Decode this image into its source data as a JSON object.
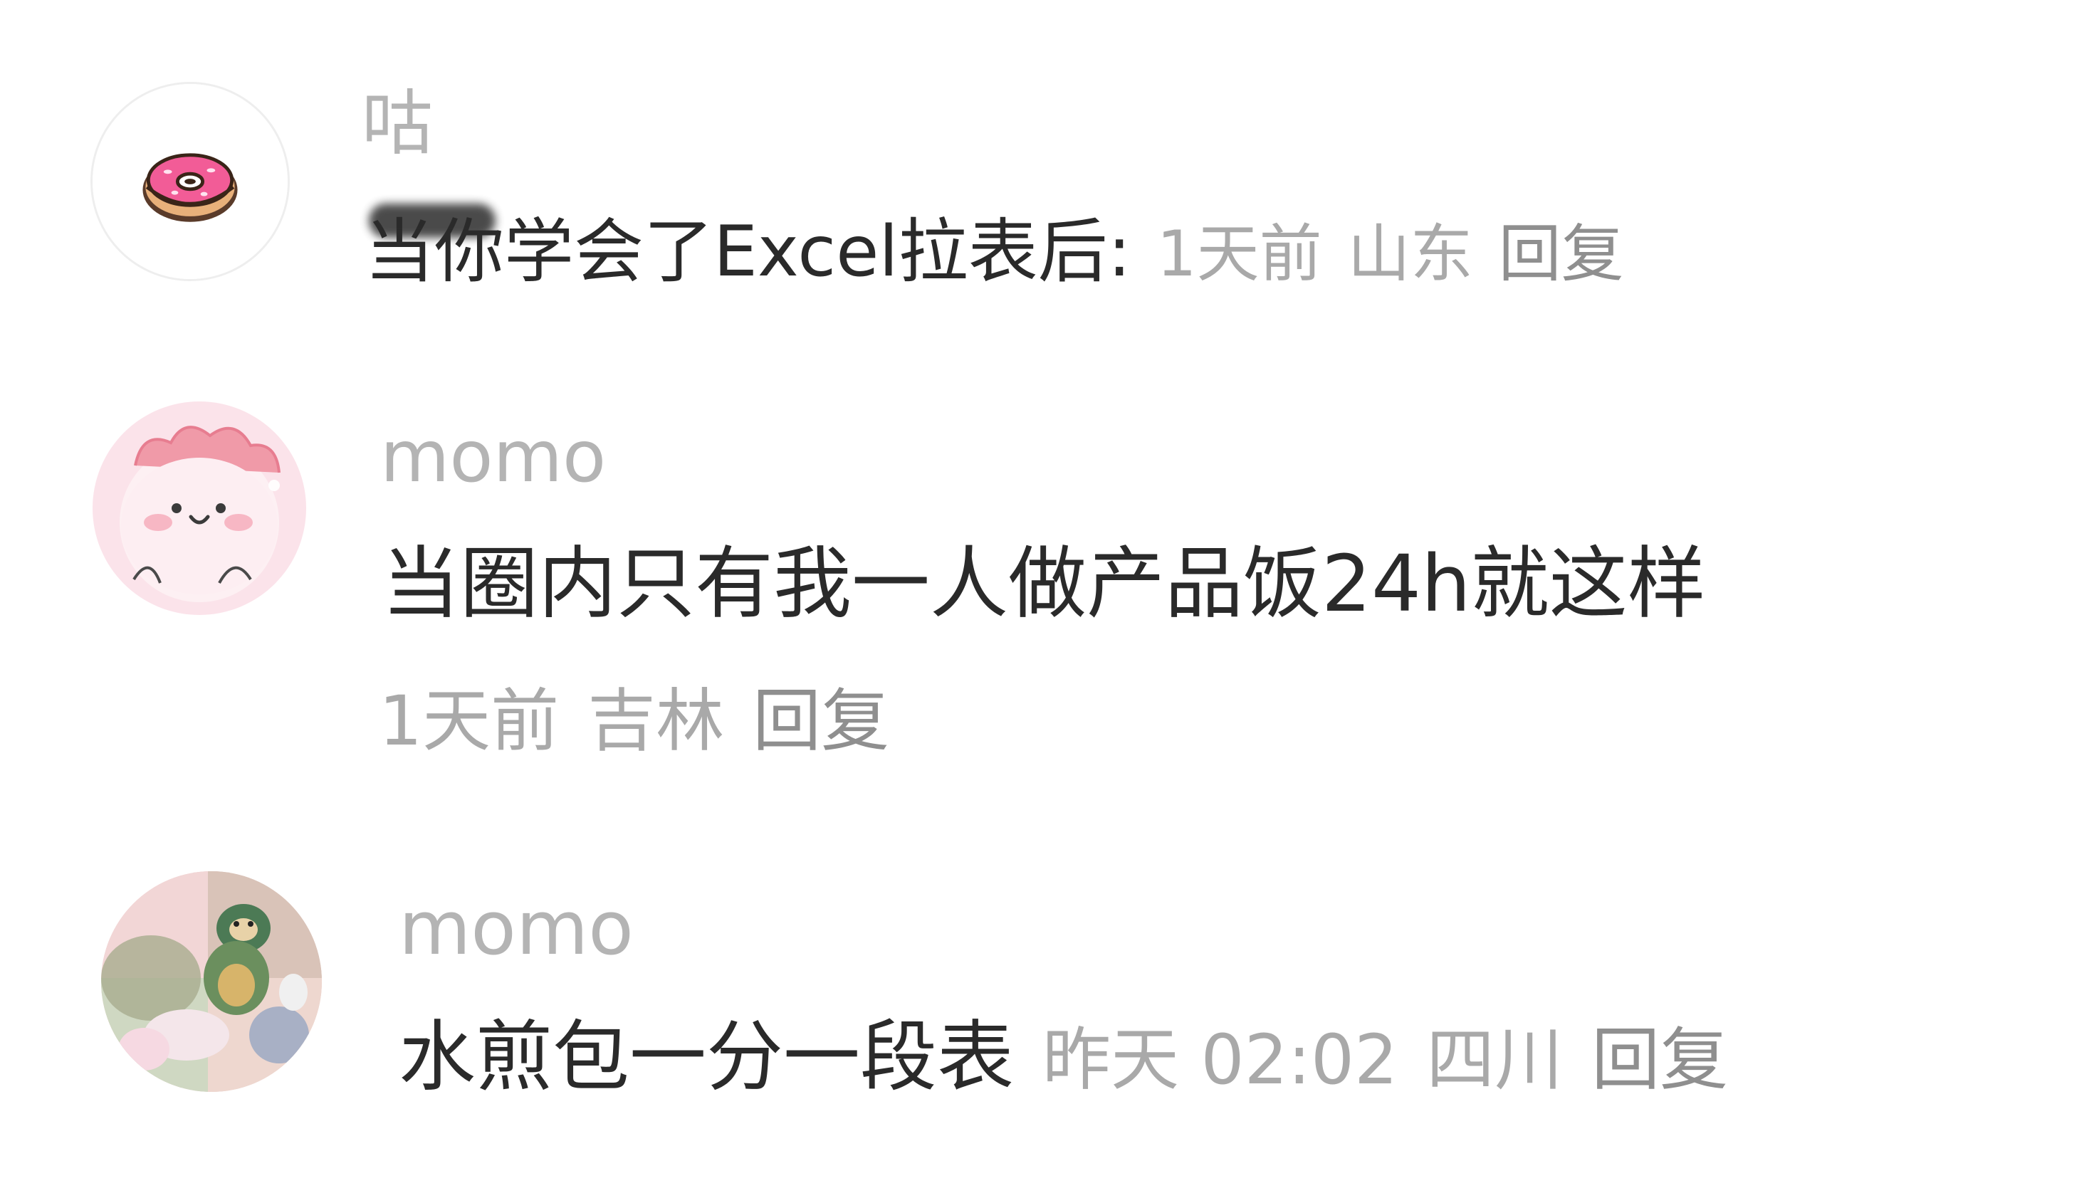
{
  "comments": [
    {
      "username": "咕",
      "text": "当你学会了Excel拉表后:",
      "time": "1天前",
      "location": "山东",
      "reply_label": "回复",
      "avatar_icon": "donut-icon"
    },
    {
      "username": "momo",
      "text": "当圈内只有我一人做产品饭24h就这样",
      "time": "1天前",
      "location": "吉林",
      "reply_label": "回复",
      "avatar_icon": "pink-dinosaur-icon"
    },
    {
      "username": "momo",
      "text": "水煎包一分一段表",
      "time": "昨天 02:02",
      "location": "四川",
      "reply_label": "回复",
      "avatar_icon": "plush-toys-photo"
    }
  ],
  "colors": {
    "username": "#b4b4b4",
    "text": "#2a2a2a",
    "meta": "#a9a9a9",
    "reply": "#8f8f8f",
    "background": "#ffffff"
  }
}
